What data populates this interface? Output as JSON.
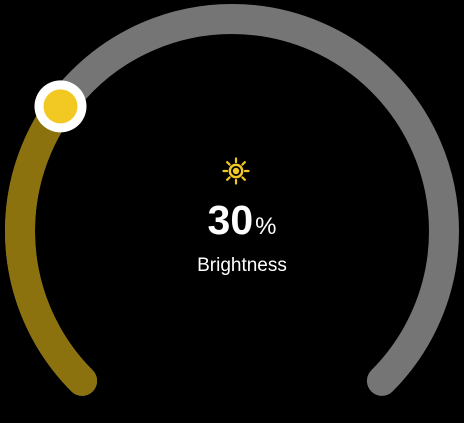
{
  "dial": {
    "value": 30,
    "min": 0,
    "max": 100,
    "unit": "%",
    "label": "Brightness",
    "icon": "sun-icon",
    "colors": {
      "track": "#757575",
      "fill": "#8c720f",
      "accent": "#f2c822",
      "knob_ring": "#ffffff",
      "text": "#ffffff",
      "background": "#000000"
    }
  }
}
